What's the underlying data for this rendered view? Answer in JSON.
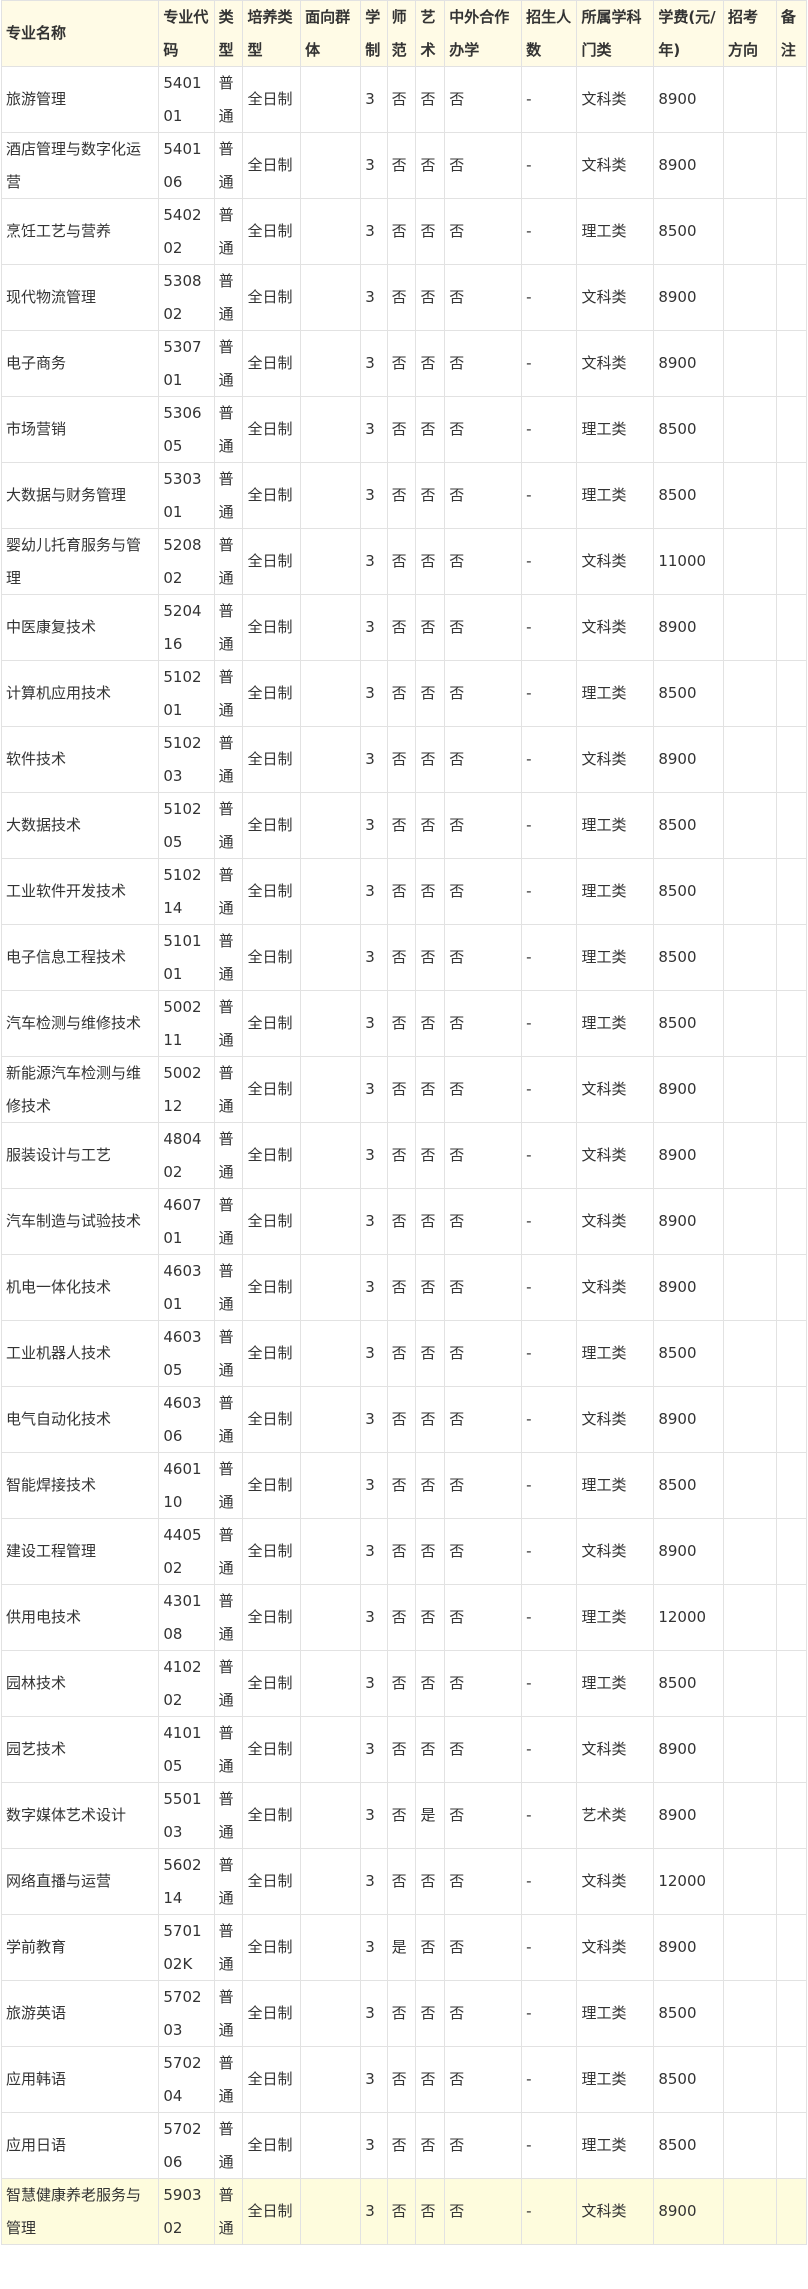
{
  "headers": [
    "专业名称",
    "专业代码",
    "类型",
    "培养类型",
    "面向群体",
    "学制",
    "师范",
    "艺术",
    "中外合作办学",
    "招生人数",
    "所属学科门类",
    "学费(元/年)",
    "招考方向",
    "备注"
  ],
  "rows": [
    [
      "旅游管理",
      "540101",
      "普通",
      "全日制",
      "",
      "3",
      "否",
      "否",
      "否",
      "-",
      "文科类",
      "8900",
      "",
      ""
    ],
    [
      "酒店管理与数字化运营",
      "540106",
      "普通",
      "全日制",
      "",
      "3",
      "否",
      "否",
      "否",
      "-",
      "文科类",
      "8900",
      "",
      ""
    ],
    [
      "烹饪工艺与营养",
      "540202",
      "普通",
      "全日制",
      "",
      "3",
      "否",
      "否",
      "否",
      "-",
      "理工类",
      "8500",
      "",
      ""
    ],
    [
      "现代物流管理",
      "530802",
      "普通",
      "全日制",
      "",
      "3",
      "否",
      "否",
      "否",
      "-",
      "文科类",
      "8900",
      "",
      ""
    ],
    [
      "电子商务",
      "530701",
      "普通",
      "全日制",
      "",
      "3",
      "否",
      "否",
      "否",
      "-",
      "文科类",
      "8900",
      "",
      ""
    ],
    [
      "市场营销",
      "530605",
      "普通",
      "全日制",
      "",
      "3",
      "否",
      "否",
      "否",
      "-",
      "理工类",
      "8500",
      "",
      ""
    ],
    [
      "大数据与财务管理",
      "530301",
      "普通",
      "全日制",
      "",
      "3",
      "否",
      "否",
      "否",
      "-",
      "理工类",
      "8500",
      "",
      ""
    ],
    [
      "婴幼儿托育服务与管理",
      "520802",
      "普通",
      "全日制",
      "",
      "3",
      "否",
      "否",
      "否",
      "-",
      "文科类",
      "11000",
      "",
      ""
    ],
    [
      "中医康复技术",
      "520416",
      "普通",
      "全日制",
      "",
      "3",
      "否",
      "否",
      "否",
      "-",
      "文科类",
      "8900",
      "",
      ""
    ],
    [
      "计算机应用技术",
      "510201",
      "普通",
      "全日制",
      "",
      "3",
      "否",
      "否",
      "否",
      "-",
      "理工类",
      "8500",
      "",
      ""
    ],
    [
      "软件技术",
      "510203",
      "普通",
      "全日制",
      "",
      "3",
      "否",
      "否",
      "否",
      "-",
      "文科类",
      "8900",
      "",
      ""
    ],
    [
      "大数据技术",
      "510205",
      "普通",
      "全日制",
      "",
      "3",
      "否",
      "否",
      "否",
      "-",
      "理工类",
      "8500",
      "",
      ""
    ],
    [
      "工业软件开发技术",
      "510214",
      "普通",
      "全日制",
      "",
      "3",
      "否",
      "否",
      "否",
      "-",
      "理工类",
      "8500",
      "",
      ""
    ],
    [
      "电子信息工程技术",
      "510101",
      "普通",
      "全日制",
      "",
      "3",
      "否",
      "否",
      "否",
      "-",
      "理工类",
      "8500",
      "",
      ""
    ],
    [
      "汽车检测与维修技术",
      "500211",
      "普通",
      "全日制",
      "",
      "3",
      "否",
      "否",
      "否",
      "-",
      "理工类",
      "8500",
      "",
      ""
    ],
    [
      "新能源汽车检测与维修技术",
      "500212",
      "普通",
      "全日制",
      "",
      "3",
      "否",
      "否",
      "否",
      "-",
      "文科类",
      "8900",
      "",
      ""
    ],
    [
      "服装设计与工艺",
      "480402",
      "普通",
      "全日制",
      "",
      "3",
      "否",
      "否",
      "否",
      "-",
      "文科类",
      "8900",
      "",
      ""
    ],
    [
      "汽车制造与试验技术",
      "460701",
      "普通",
      "全日制",
      "",
      "3",
      "否",
      "否",
      "否",
      "-",
      "文科类",
      "8900",
      "",
      ""
    ],
    [
      "机电一体化技术",
      "460301",
      "普通",
      "全日制",
      "",
      "3",
      "否",
      "否",
      "否",
      "-",
      "文科类",
      "8900",
      "",
      ""
    ],
    [
      "工业机器人技术",
      "460305",
      "普通",
      "全日制",
      "",
      "3",
      "否",
      "否",
      "否",
      "-",
      "理工类",
      "8500",
      "",
      ""
    ],
    [
      "电气自动化技术",
      "460306",
      "普通",
      "全日制",
      "",
      "3",
      "否",
      "否",
      "否",
      "-",
      "文科类",
      "8900",
      "",
      ""
    ],
    [
      "智能焊接技术",
      "460110",
      "普通",
      "全日制",
      "",
      "3",
      "否",
      "否",
      "否",
      "-",
      "理工类",
      "8500",
      "",
      ""
    ],
    [
      "建设工程管理",
      "440502",
      "普通",
      "全日制",
      "",
      "3",
      "否",
      "否",
      "否",
      "-",
      "文科类",
      "8900",
      "",
      ""
    ],
    [
      "供用电技术",
      "430108",
      "普通",
      "全日制",
      "",
      "3",
      "否",
      "否",
      "否",
      "-",
      "理工类",
      "12000",
      "",
      ""
    ],
    [
      "园林技术",
      "410202",
      "普通",
      "全日制",
      "",
      "3",
      "否",
      "否",
      "否",
      "-",
      "理工类",
      "8500",
      "",
      ""
    ],
    [
      "园艺技术",
      "410105",
      "普通",
      "全日制",
      "",
      "3",
      "否",
      "否",
      "否",
      "-",
      "文科类",
      "8900",
      "",
      ""
    ],
    [
      "数字媒体艺术设计",
      "550103",
      "普通",
      "全日制",
      "",
      "3",
      "否",
      "是",
      "否",
      "-",
      "艺术类",
      "8900",
      "",
      ""
    ],
    [
      "网络直播与运营",
      "560214",
      "普通",
      "全日制",
      "",
      "3",
      "否",
      "否",
      "否",
      "-",
      "文科类",
      "12000",
      "",
      ""
    ],
    [
      "学前教育",
      "570102K",
      "普通",
      "全日制",
      "",
      "3",
      "是",
      "否",
      "否",
      "-",
      "文科类",
      "8900",
      "",
      ""
    ],
    [
      "旅游英语",
      "570203",
      "普通",
      "全日制",
      "",
      "3",
      "否",
      "否",
      "否",
      "-",
      "理工类",
      "8500",
      "",
      ""
    ],
    [
      "应用韩语",
      "570204",
      "普通",
      "全日制",
      "",
      "3",
      "否",
      "否",
      "否",
      "-",
      "理工类",
      "8500",
      "",
      ""
    ],
    [
      "应用日语",
      "570206",
      "普通",
      "全日制",
      "",
      "3",
      "否",
      "否",
      "否",
      "-",
      "理工类",
      "8500",
      "",
      ""
    ],
    [
      "智慧健康养老服务与管理",
      "590302",
      "普通",
      "全日制",
      "",
      "3",
      "否",
      "否",
      "否",
      "-",
      "文科类",
      "8900",
      "",
      ""
    ]
  ],
  "highlight_row_index": 32
}
